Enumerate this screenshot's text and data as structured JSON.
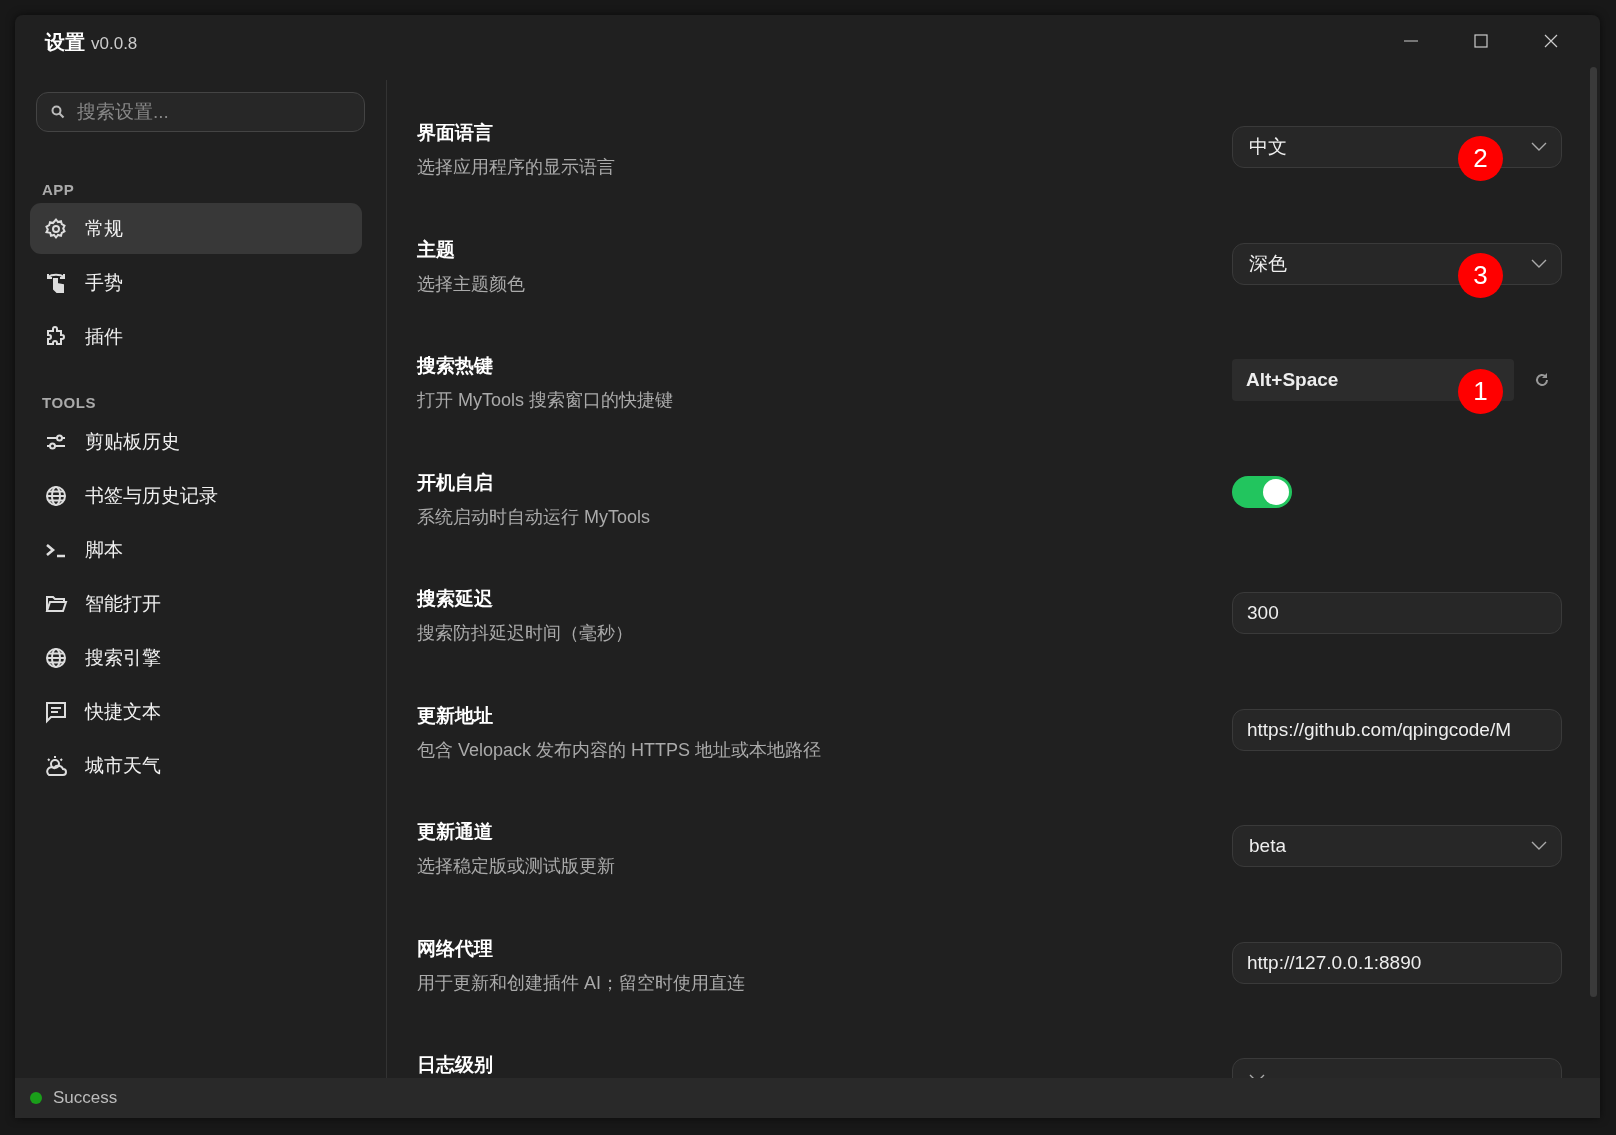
{
  "window": {
    "title": "设置",
    "version": "v0.0.8"
  },
  "sidebar": {
    "search": {
      "placeholder": "搜索设置..."
    },
    "sections": [
      {
        "heading": "APP",
        "items": [
          {
            "label": "常规",
            "selected": true
          },
          {
            "label": "手势",
            "selected": false
          },
          {
            "label": "插件",
            "selected": false
          }
        ]
      },
      {
        "heading": "TOOLS",
        "items": [
          {
            "label": "剪贴板历史",
            "selected": false
          },
          {
            "label": "书签与历史记录",
            "selected": false
          },
          {
            "label": "脚本",
            "selected": false
          },
          {
            "label": "智能打开",
            "selected": false
          },
          {
            "label": "搜索引擎",
            "selected": false
          },
          {
            "label": "快捷文本",
            "selected": false
          },
          {
            "label": "城市天气",
            "selected": false
          }
        ]
      }
    ]
  },
  "settings": [
    {
      "title": "界面语言",
      "description": "选择应用程序的显示语言",
      "control": {
        "kind": "select",
        "value": "中文",
        "badge": "2"
      }
    },
    {
      "title": "主题",
      "description": "选择主题颜色",
      "control": {
        "kind": "select",
        "value": "深色",
        "badge": "3"
      }
    },
    {
      "title": "搜索热键",
      "description": "打开 MyTools 搜索窗口的快捷键",
      "control": {
        "kind": "hotkey",
        "value": "Alt+Space",
        "badge": "1"
      }
    },
    {
      "title": "开机自启",
      "description": "系统启动时自动运行 MyTools",
      "control": {
        "kind": "toggle",
        "on": true
      }
    },
    {
      "title": "搜索延迟",
      "description": "搜索防抖延迟时间（毫秒）",
      "control": {
        "kind": "input",
        "value": "300"
      }
    },
    {
      "title": "更新地址",
      "description": "包含 Velopack 发布内容的 HTTPS 地址或本地路径",
      "control": {
        "kind": "input",
        "value": "https://github.com/qpingcode/M"
      }
    },
    {
      "title": "更新通道",
      "description": "选择稳定版或测试版更新",
      "control": {
        "kind": "select",
        "value": "beta"
      }
    },
    {
      "title": "网络代理",
      "description": "用于更新和创建插件 AI；留空时使用直连",
      "control": {
        "kind": "input",
        "value": "http://127.0.0.1:8890"
      }
    },
    {
      "title": "日志级别",
      "control": {
        "kind": "select"
      }
    }
  ],
  "status_bar": {
    "text": "Success",
    "color": "#1a9e1a"
  }
}
